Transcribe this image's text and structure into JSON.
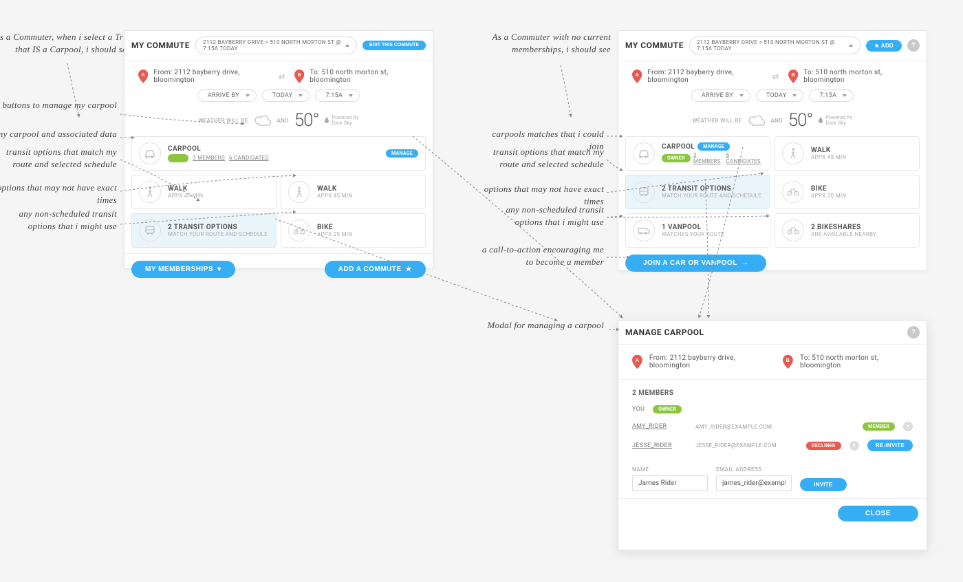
{
  "annotations": {
    "a_intro": "As a Commuter, when i select a Trip that IS a Carpool, i should see",
    "a_manage": "buttons to manage my carpool",
    "a_carpool": "my carpool and associated data",
    "a_transit": "transit options that match my route and selected schedule",
    "a_notimes": "options that may not have exact times",
    "a_nonsched": "any non-scheduled transit options that i might use",
    "b_intro": "As a Commuter with no current memberships, i should see",
    "b_matches": "carpools matches that i could join",
    "b_transit": "transit options that match my route and selected schedule",
    "b_notimes": "options that may not have exact times",
    "b_nonsched": "any non-scheduled transit options that i might use",
    "b_cta": "a call-to-action encouraging me to become a member",
    "c_title": "Modal for managing a carpool"
  },
  "panelA": {
    "title": "MY COMMUTE",
    "route_pill": "2112 BAYBERRY DRIVE > 510 NORTH MORTON ST @ 7:15A TODAY",
    "edit": "EDIT THIS COMMUTE",
    "from": "From: 2112 bayberry drive, bloomington",
    "to": "To: 510 north morton st, bloomington",
    "sel1": "ARRIVE BY",
    "sel2": "TODAY",
    "sel3": "7:15A",
    "weather_lbl": "WEATHER WILL BE",
    "and": "AND",
    "temp": "50°",
    "darksky": "Powered by",
    "darksky2": "Dark Sky",
    "c_carpool": {
      "title": "CARPOOL",
      "members": "3 MEMBERS",
      "candidates": "6 CANDIDATES",
      "manage": "MANAGE"
    },
    "c_walk1": {
      "title": "WALK",
      "sub": "APPX 45 MIN"
    },
    "c_walk2": {
      "title": "WALK",
      "sub": "APPX 45 MIN"
    },
    "c_transit": {
      "title": "2 TRANSIT OPTIONS",
      "sub": "MATCH YOUR ROUTE AND SCHEDULE"
    },
    "c_bike": {
      "title": "BIKE",
      "sub": "APPX 20 MIN"
    },
    "btn_memberships": "MY MEMBERSHIPS",
    "btn_add": "ADD A COMMUTE"
  },
  "panelB": {
    "title": "MY COMMUTE",
    "route_pill": "2112 BAYBERRY DRIVE > 510 NORTH MORTON ST @ 7:15A TODAY",
    "add": "ADD",
    "from": "From: 2112 bayberry drive, bloomington",
    "to": "To: 510 north morton st, bloomington",
    "sel1": "ARRIVE BY",
    "sel2": "TODAY",
    "sel3": "7:15A",
    "weather_lbl": "WEATHER WILL BE",
    "and": "AND",
    "temp": "50°",
    "darksky": "Powered by",
    "darksky2": "Dark Sky",
    "c_carpool": {
      "title": "CARPOOL",
      "owner": "OWNER",
      "members": "3 MEMBERS",
      "candidates": "6 CANDIDATES",
      "manage": "MANAGE"
    },
    "c_walk": {
      "title": "WALK",
      "sub": "APPX 45 MIN"
    },
    "c_transit": {
      "title": "2 TRANSIT OPTIONS",
      "sub": "MATCH YOUR ROUTE AND SCHEDULE"
    },
    "c_bike": {
      "title": "BIKE",
      "sub": "APPX 20 MIN"
    },
    "c_van": {
      "title": "1 VANPOOL",
      "sub": "MATCHES YOUR ROUTE"
    },
    "c_bsh": {
      "title": "2 BIKESHARES",
      "sub": "ARE AVAILABLE NEARBY"
    },
    "cta": "JOIN A CAR OR VANPOOL"
  },
  "panelC": {
    "title": "MANAGE CARPOOL",
    "from": "From: 2112 bayberry drive, bloomington",
    "to": "To: 510 north morton st, bloomington",
    "members_title": "2 MEMBERS",
    "you": "YOU",
    "owner_badge": "OWNER",
    "m1": {
      "name": "AMY_RIDER",
      "email": "AMY_RIDER@EXAMPLE.COM",
      "status": "MEMBER"
    },
    "m2": {
      "name": "JESSE_RIDER",
      "email": "JESSE_RIDER@EXAMPLE.COM",
      "status": "DECLINED",
      "reinvite": "RE-INVITE"
    },
    "name_lbl": "NAME",
    "email_lbl": "EMAIL ADDRESS",
    "name_val": "James Rider",
    "email_val": "james_rider@example.com",
    "invite": "INVITE",
    "close": "CLOSE"
  }
}
